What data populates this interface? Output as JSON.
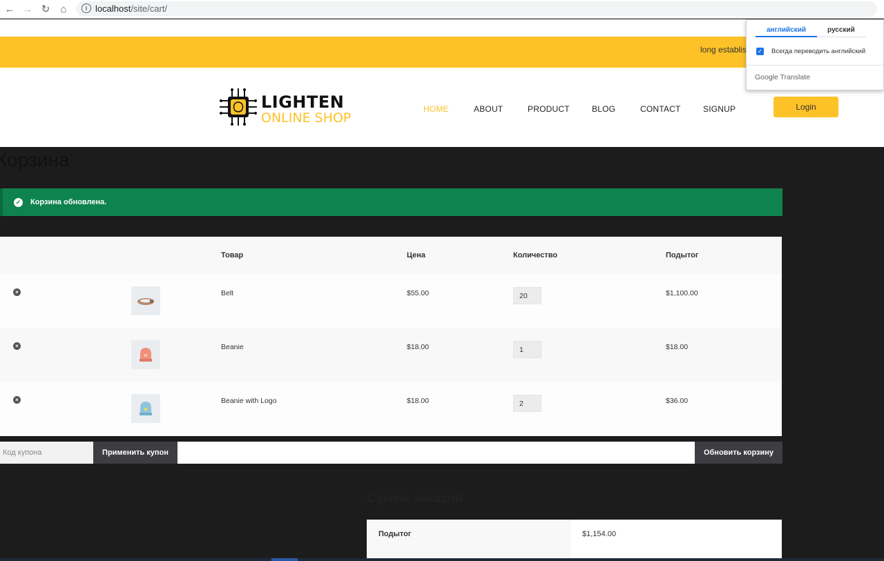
{
  "browser": {
    "url_host": "localhost",
    "url_path": "/site/cart/",
    "back_icon": "arrow-left-icon",
    "forward_icon": "arrow-right-icon",
    "reload_icon": "reload-icon",
    "home_icon": "home-icon"
  },
  "top_strip": {
    "text": "long establish"
  },
  "logo": {
    "line1": "LIGHTEN",
    "line2": "ONLINE SHOP"
  },
  "nav": {
    "items": [
      {
        "label": "HOME",
        "active": true
      },
      {
        "label": "ABOUT",
        "active": false
      },
      {
        "label": "PRODUCT",
        "active": false
      },
      {
        "label": "BLOG",
        "active": false
      },
      {
        "label": "CONTACT",
        "active": false
      },
      {
        "label": "SIGNUP",
        "active": false
      }
    ],
    "login_label": "Login"
  },
  "translate_popup": {
    "tab_source": "английский",
    "tab_target": "русский",
    "always_translate_label": "Всегда переводить английский",
    "always_translate_checked": true,
    "brand": "Google Translate"
  },
  "page": {
    "title": "Корзина",
    "notice": "Корзина обновлена."
  },
  "cart": {
    "headers": {
      "product": "Товар",
      "price": "Цена",
      "quantity": "Количество",
      "subtotal": "Подытог"
    },
    "rows": [
      {
        "name": "Belt",
        "price": "$55.00",
        "qty": "20",
        "subtotal": "$1,100.00"
      },
      {
        "name": "Beanie",
        "price": "$18.00",
        "qty": "1",
        "subtotal": "$18.00"
      },
      {
        "name": "Beanie with Logo",
        "price": "$18.00",
        "qty": "2",
        "subtotal": "$36.00"
      }
    ],
    "coupon_placeholder": "Код купона",
    "apply_coupon_label": "Применить купон",
    "update_cart_label": "Обновить корзину"
  },
  "totals": {
    "title": "Сумма заказов",
    "subtotal_label": "Подытог",
    "subtotal_value": "$1,154.00"
  },
  "colors": {
    "accent": "#fdc228",
    "notice_bg": "#0f834d",
    "dark_button": "#3d3d42",
    "page_bg": "#1c1c1c"
  }
}
